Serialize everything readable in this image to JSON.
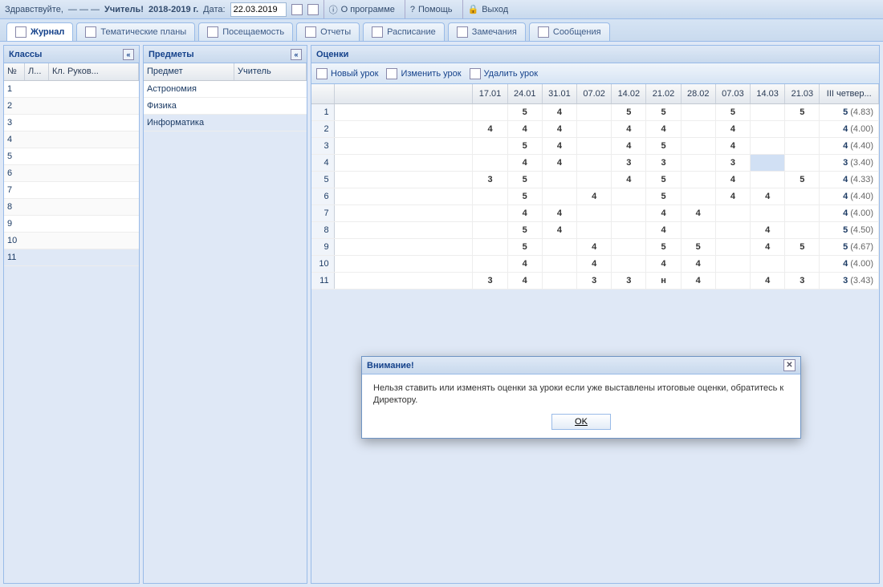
{
  "topbar": {
    "greeting": "Здравствуйте,",
    "username": "— — —",
    "role": "Учитель!",
    "year": "2018-2019 г.",
    "date_label": "Дата:",
    "date_value": "22.03.2019",
    "about": "О программе",
    "help": "Помощь",
    "exit": "Выход"
  },
  "tabs": [
    {
      "label": "Журнал",
      "active": true
    },
    {
      "label": "Тематические планы",
      "active": false
    },
    {
      "label": "Посещаемость",
      "active": false
    },
    {
      "label": "Отчеты",
      "active": false
    },
    {
      "label": "Расписание",
      "active": false
    },
    {
      "label": "Замечания",
      "active": false
    },
    {
      "label": "Сообщения",
      "active": false
    }
  ],
  "classes": {
    "title": "Классы",
    "columns": {
      "num": "№",
      "letter": "Л...",
      "teacher": "Кл. Руков..."
    },
    "rows": [
      1,
      2,
      3,
      4,
      5,
      6,
      7,
      8,
      9,
      10,
      11
    ],
    "selected": 11
  },
  "subjects": {
    "title": "Предметы",
    "columns": {
      "subject": "Предмет",
      "teacher": "Учитель"
    },
    "rows": [
      "Астрономия",
      "Физика",
      "Информатика"
    ],
    "selected": "Информатика"
  },
  "grades": {
    "title": "Оценки",
    "toolbar": {
      "new": "Новый урок",
      "edit": "Изменить урок",
      "delete": "Удалить урок"
    },
    "dates": [
      "17.01",
      "24.01",
      "31.01",
      "07.02",
      "14.02",
      "21.02",
      "28.02",
      "07.03",
      "14.03",
      "21.03"
    ],
    "final_header": "III четвер...",
    "rows": [
      {
        "n": 1,
        "g": {
          "24.01": "5",
          "31.01": "4",
          "14.02": "5",
          "21.02": "5",
          "07.03": "5",
          "21.03": "5"
        },
        "final": "5",
        "avg": "(4.83)"
      },
      {
        "n": 2,
        "g": {
          "17.01": "4",
          "24.01": "4",
          "31.01": "4",
          "14.02": "4",
          "21.02": "4",
          "07.03": "4"
        },
        "final": "4",
        "avg": "(4.00)"
      },
      {
        "n": 3,
        "g": {
          "24.01": "5",
          "31.01": "4",
          "14.02": "4",
          "21.02": "5",
          "07.03": "4"
        },
        "final": "4",
        "avg": "(4.40)"
      },
      {
        "n": 4,
        "g": {
          "24.01": "4",
          "31.01": "4",
          "14.02": "3",
          "21.02": "3",
          "07.03": "3"
        },
        "final": "3",
        "avg": "(3.40)",
        "selcell": "14.03"
      },
      {
        "n": 5,
        "g": {
          "17.01": "3",
          "24.01": "5",
          "14.02": "4",
          "21.02": "5",
          "07.03": "4",
          "21.03": "5"
        },
        "final": "4",
        "avg": "(4.33)"
      },
      {
        "n": 6,
        "g": {
          "24.01": "5",
          "07.02": "4",
          "21.02": "5",
          "07.03": "4",
          "14.03": "4"
        },
        "final": "4",
        "avg": "(4.40)"
      },
      {
        "n": 7,
        "g": {
          "24.01": "4",
          "31.01": "4",
          "21.02": "4",
          "28.02": "4"
        },
        "final": "4",
        "avg": "(4.00)"
      },
      {
        "n": 8,
        "g": {
          "24.01": "5",
          "31.01": "4",
          "21.02": "4",
          "14.03": "4"
        },
        "final": "5",
        "avg": "(4.50)"
      },
      {
        "n": 9,
        "g": {
          "24.01": "5",
          "07.02": "4",
          "21.02": "5",
          "28.02": "5",
          "14.03": "4",
          "21.03": "5"
        },
        "final": "5",
        "avg": "(4.67)"
      },
      {
        "n": 10,
        "g": {
          "24.01": "4",
          "07.02": "4",
          "21.02": "4",
          "28.02": "4"
        },
        "final": "4",
        "avg": "(4.00)"
      },
      {
        "n": 11,
        "g": {
          "17.01": "3",
          "24.01": "4",
          "07.02": "3",
          "14.02": "3",
          "21.02": "н",
          "28.02": "4",
          "14.03": "4",
          "21.03": "3"
        },
        "final": "3",
        "avg": "(3.43)"
      }
    ]
  },
  "dialog": {
    "title": "Внимание!",
    "body": "Нельзя ставить или изменять оценки за уроки если уже выставлены итоговые оценки, обратитесь к Директору.",
    "ok": "OK"
  }
}
